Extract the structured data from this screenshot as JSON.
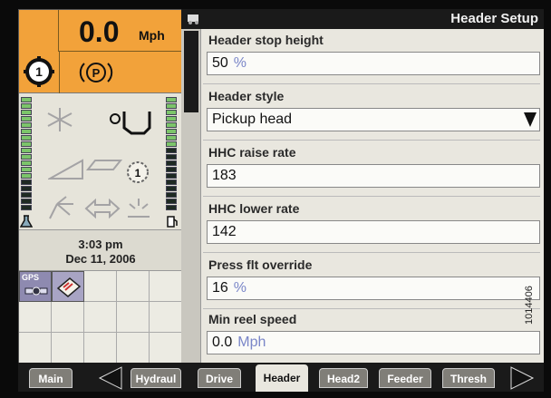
{
  "status": {
    "speed_value": "0.0",
    "speed_unit": "Mph",
    "gear": "1",
    "park": "P",
    "time": "3:03 pm",
    "date": "Dec 11, 2006",
    "gps_label": "GPS",
    "range_number": "1"
  },
  "titlebar": {
    "title": "Header Setup"
  },
  "settings": [
    {
      "label": "Header stop height",
      "value": "50",
      "unit": "%",
      "type": "field"
    },
    {
      "label": "Header style",
      "value": "Pickup head",
      "unit": "",
      "type": "dropdown"
    },
    {
      "label": "HHC raise rate",
      "value": "183",
      "unit": "",
      "type": "field"
    },
    {
      "label": "HHC lower rate",
      "value": "142",
      "unit": "",
      "type": "field"
    },
    {
      "label": "Press flt override",
      "value": "16",
      "unit": "%",
      "type": "field"
    },
    {
      "label": "Min reel speed",
      "value": "0.0",
      "unit": "Mph",
      "type": "field"
    }
  ],
  "tabs": [
    {
      "label": "Main",
      "active": false
    },
    {
      "label": "Hydraul",
      "active": false
    },
    {
      "label": "Drive",
      "active": false
    },
    {
      "label": "Header",
      "active": true
    },
    {
      "label": "Head2",
      "active": false
    },
    {
      "label": "Feeder",
      "active": false
    },
    {
      "label": "Thresh",
      "active": false
    }
  ],
  "watermark": "1014406",
  "colors": {
    "status_orange": "#f2a23a",
    "panel_bg": "#e9e7df",
    "unit_text": "#7a86c8",
    "gauge_green": "#7cc46a",
    "gauge_dark": "#1e2a22"
  },
  "gauges": {
    "left_level": 0.3,
    "right_level": 0.55
  }
}
